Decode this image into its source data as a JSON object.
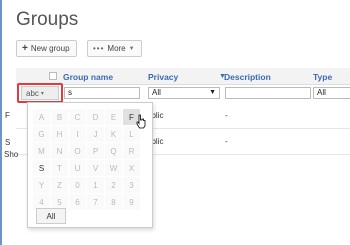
{
  "page": {
    "title": "Groups"
  },
  "toolbar": {
    "new_group_label": "New group",
    "more_label": "More"
  },
  "table": {
    "columns": [
      "Group name",
      "Privacy",
      "Description",
      "Type"
    ],
    "filters": {
      "abc_label": "abc",
      "name_value": "s",
      "privacy_value": "All",
      "description_value": "",
      "type_value": "All"
    },
    "rows": [
      {
        "first_letter": "F",
        "privacy": "ublic",
        "description": "-"
      },
      {
        "first_letter": "S",
        "privacy": "ublic",
        "description": "-"
      }
    ],
    "footer_text": "Sho"
  },
  "letter_picker": {
    "letters": [
      "A",
      "B",
      "C",
      "D",
      "E",
      "F",
      "G",
      "H",
      "I",
      "J",
      "K",
      "L",
      "M",
      "N",
      "O",
      "P",
      "Q",
      "R",
      "S",
      "T",
      "U",
      "V",
      "W",
      "X",
      "Y",
      "Z",
      "0",
      "1",
      "2",
      "3",
      "4",
      "5",
      "6",
      "7",
      "8",
      "9"
    ],
    "enabled": [
      "F",
      "S"
    ],
    "hovered": "F",
    "all_label": "All"
  },
  "colors": {
    "accent": "#3c6bb0",
    "highlight": "#e23b3b"
  }
}
